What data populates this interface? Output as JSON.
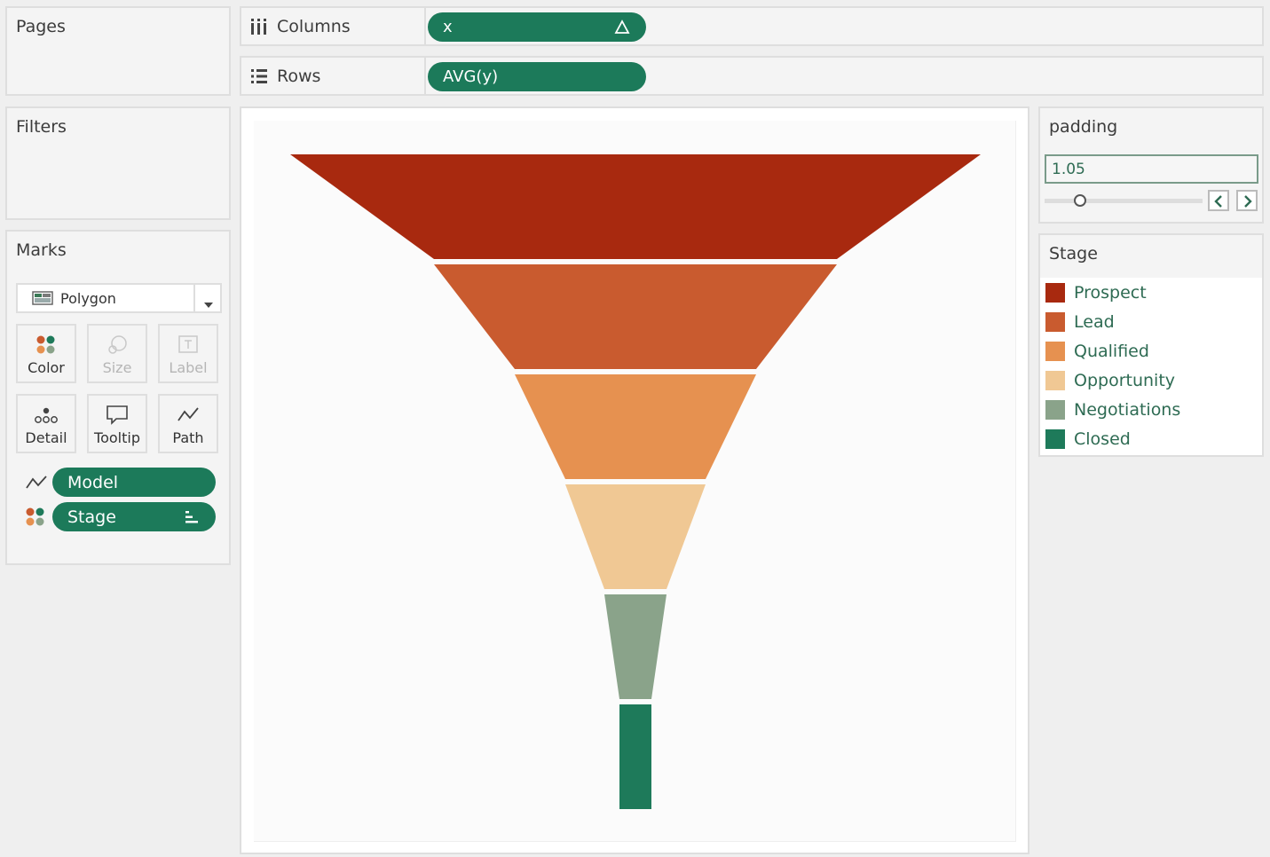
{
  "pages": {
    "title": "Pages"
  },
  "filters": {
    "title": "Filters"
  },
  "marks": {
    "title": "Marks",
    "mark_type": "Polygon",
    "cards": [
      {
        "label": "Color",
        "icon": "color-dots-icon",
        "enabled": true
      },
      {
        "label": "Size",
        "icon": "size-icon",
        "enabled": false
      },
      {
        "label": "Label",
        "icon": "label-icon",
        "enabled": false
      },
      {
        "label": "Detail",
        "icon": "detail-icon",
        "enabled": true
      },
      {
        "label": "Tooltip",
        "icon": "tooltip-icon",
        "enabled": true
      },
      {
        "label": "Path",
        "icon": "path-icon",
        "enabled": true
      }
    ],
    "fields": [
      {
        "label": "Model",
        "icon": "path-icon"
      },
      {
        "label": "Stage",
        "icon": "color-dots-icon"
      }
    ]
  },
  "columns": {
    "label": "Columns",
    "pill": "x",
    "pill_icon": "delta-icon"
  },
  "rows": {
    "label": "Rows",
    "pill": "AVG(y)"
  },
  "parameter": {
    "title": "padding",
    "value": "1.05",
    "slider_fraction": 0.2
  },
  "legend": {
    "title": "Stage",
    "items": [
      {
        "label": "Prospect",
        "color": "#a8290f"
      },
      {
        "label": "Lead",
        "color": "#c95b2f"
      },
      {
        "label": "Qualified",
        "color": "#e69150"
      },
      {
        "label": "Opportunity",
        "color": "#f0c894"
      },
      {
        "label": "Negotiations",
        "color": "#8aa38a"
      },
      {
        "label": "Closed",
        "color": "#1e7a5a"
      }
    ]
  },
  "chart_data": {
    "type": "funnel",
    "title": "",
    "xlabel": "",
    "ylabel": "",
    "categories": [
      "Prospect",
      "Lead",
      "Qualified",
      "Opportunity",
      "Negotiations",
      "Closed"
    ],
    "widths": [
      778,
      454,
      272,
      158,
      70,
      36
    ],
    "colors": [
      "#a8290f",
      "#c95b2f",
      "#e69150",
      "#f0c894",
      "#8aa38a",
      "#1e7a5a"
    ]
  }
}
